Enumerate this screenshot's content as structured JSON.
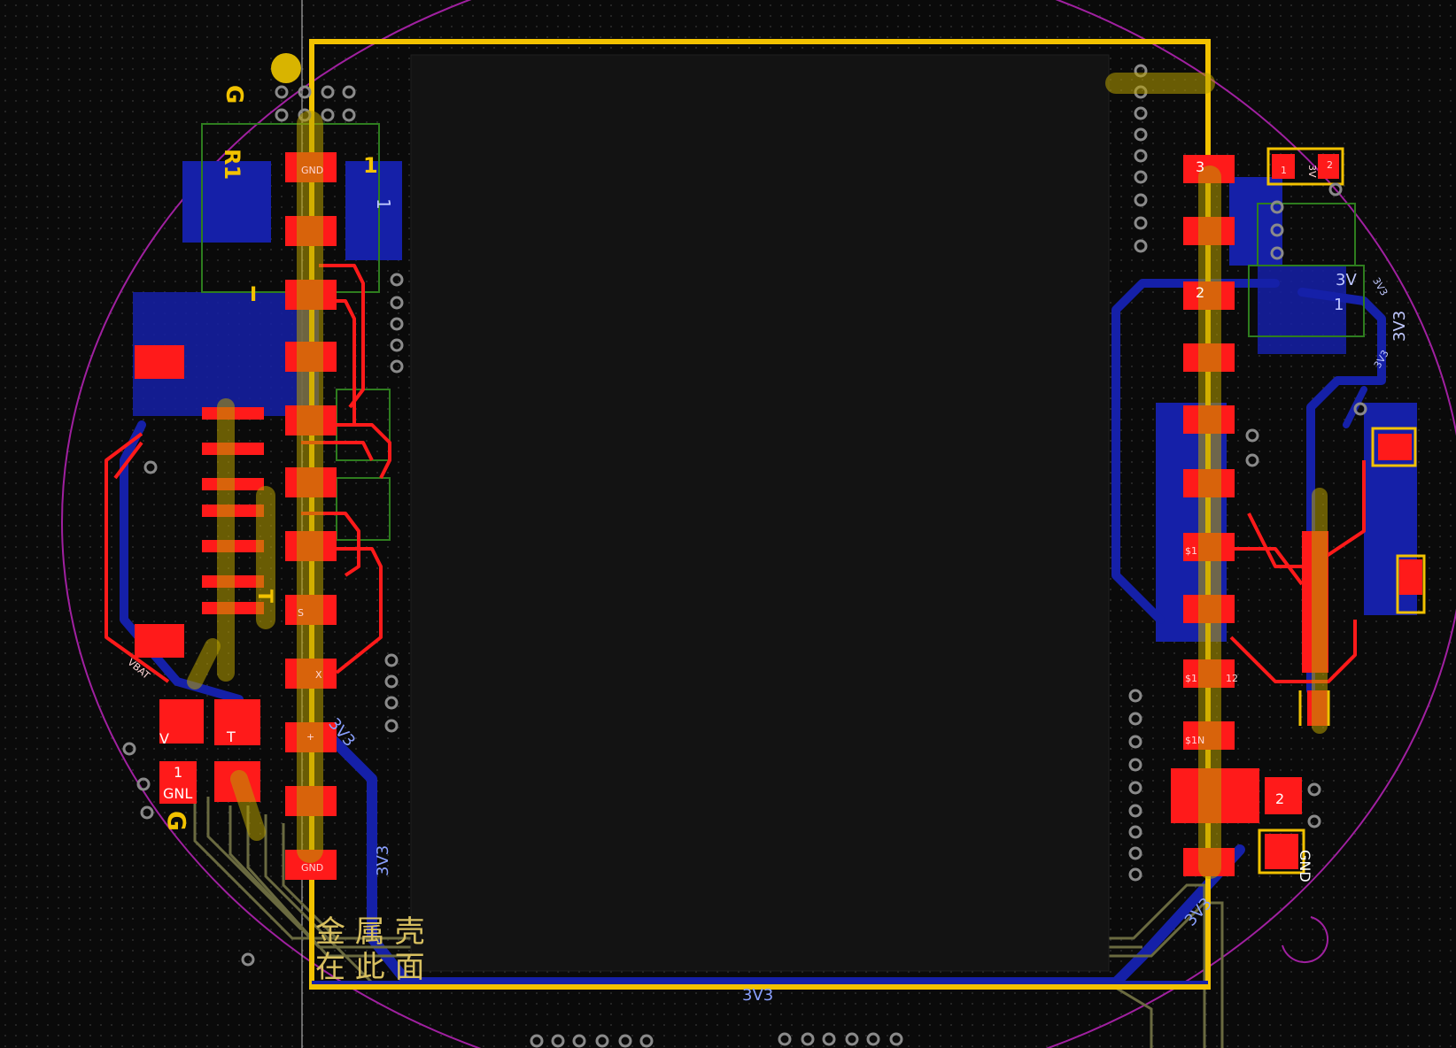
{
  "app": {
    "view": "PCB layout editor canvas"
  },
  "colors": {
    "background": "#0a0a0a",
    "grid_dot": "#2a2a2a",
    "board_outline": "#a020a0",
    "front_copper": "#ff1a1a",
    "back_copper": "#1520a8",
    "silkscreen": "#f2c200",
    "fab": "#2e7d1e",
    "via": "#8a8a8a",
    "display_area": "#131313"
  },
  "silkscreen_labels": {
    "g_top": "G",
    "r1": "R1",
    "pin1_right_of_header": "1",
    "g_bottom": "G",
    "cjk_line1": "金 属 壳",
    "cjk_line2": "在 此 面",
    "i_mark": "I",
    "t_mark": "T"
  },
  "pad_labels": {
    "left_gnd_top": "GND",
    "left_gnd_bottom": "GND",
    "left_s": "S",
    "left_x": "X",
    "left_v_plus": "+",
    "left_bat_1": "1",
    "left_gnl": "GNL",
    "left_v": "V",
    "left_t": "T",
    "right_2": "2",
    "right_3": "3",
    "right_1_top": "1",
    "right_s1": "$1",
    "right_s1_2": "$1",
    "right_s1n": "$1N",
    "right_12": "12",
    "right_gnd": "GND",
    "right_2b": "2",
    "right_1b": "1",
    "right_3v_pad": "3V"
  },
  "net_labels": {
    "vbat": "VBAT",
    "3v3_left_vertical": "3V3",
    "3v3_left_diag": "3V3",
    "3v3_bottom": "3V3",
    "3v3_bottom_right": "3V3",
    "3v3_right_vertical": "3V3",
    "3v3_right_top": "3V3",
    "3v3_right_mid": "3V3",
    "3v_right": "3V",
    "pad1_right": "1",
    "pad1_left_big": "1"
  }
}
